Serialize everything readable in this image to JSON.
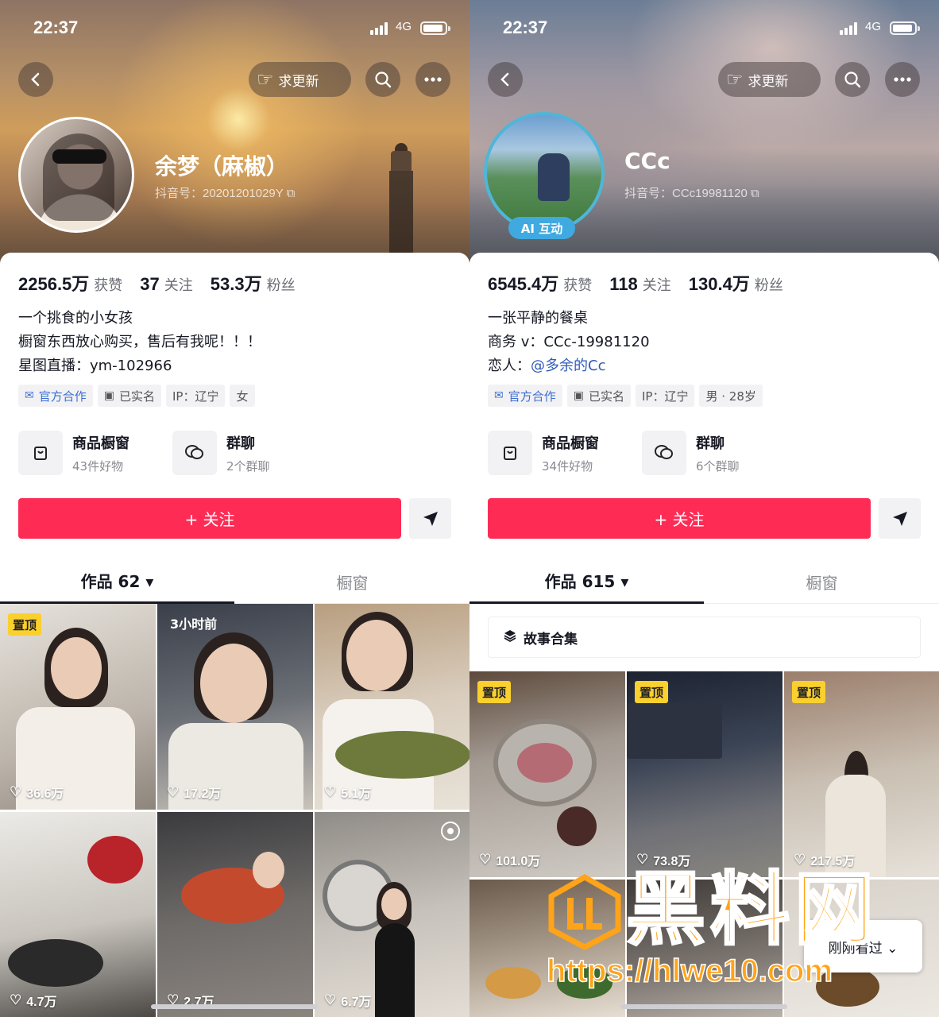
{
  "status": {
    "time": "22:37",
    "network": "4G"
  },
  "header": {
    "request_update": "求更新"
  },
  "left": {
    "name": "余梦（麻椒）",
    "uid": "抖音号：20201201029Y",
    "stats": [
      {
        "num": "2256.5万",
        "label": "获赞"
      },
      {
        "num": "37",
        "label": "关注"
      },
      {
        "num": "53.3万",
        "label": "粉丝"
      }
    ],
    "bio": [
      "一个挑食的小女孩",
      "橱窗东西放心购买，售后有我呢！！！",
      "星图直播：ym-102966"
    ],
    "tags": [
      "官方合作",
      "已实名",
      "IP：辽宁",
      "女"
    ],
    "shortcuts": [
      {
        "title": "商品橱窗",
        "sub": "43件好物"
      },
      {
        "title": "群聊",
        "sub": "2个群聊"
      }
    ],
    "follow": "+ 关注",
    "tabs": [
      "作品 62 ▾",
      "橱窗"
    ],
    "tiles": [
      {
        "badge": "置顶",
        "likes": "36.6万"
      },
      {
        "ago": "3小时前",
        "likes": "17.2万"
      },
      {
        "likes": "5.1万"
      },
      {
        "likes": "4.7万"
      },
      {
        "likes": "2.7万"
      },
      {
        "likes": "6.7万"
      }
    ]
  },
  "right": {
    "name": "CCc",
    "uid": "抖音号：CCc19981120",
    "ai_badge": "AI 互动",
    "stats": [
      {
        "num": "6545.4万",
        "label": "获赞"
      },
      {
        "num": "118",
        "label": "关注"
      },
      {
        "num": "130.4万",
        "label": "粉丝"
      }
    ],
    "bio_line1": "一张平静的餐桌",
    "bio_line2": "商务 v：CCc-19981120",
    "bio_line3_prefix": "恋人：",
    "bio_line3_mention": "@多余的Cc",
    "tags": [
      "官方合作",
      "已实名",
      "IP：辽宁",
      "男 · 28岁"
    ],
    "shortcuts": [
      {
        "title": "商品橱窗",
        "sub": "34件好物"
      },
      {
        "title": "群聊",
        "sub": "6个群聊"
      }
    ],
    "follow": "+ 关注",
    "tabs": [
      "作品 615 ▾",
      "橱窗"
    ],
    "story": "故事合集",
    "tiles": [
      {
        "badge": "置顶",
        "likes": "101.0万"
      },
      {
        "badge": "置顶",
        "likes": "73.8万"
      },
      {
        "badge": "置顶",
        "likes": "217.5万"
      }
    ],
    "recent": "刚刚看过 ⌄"
  },
  "watermark": {
    "big": "黑料网",
    "url": "https://hlwe10.com"
  },
  "colors": {
    "accent": "#fe2c55",
    "badge": "#fad02e",
    "watermark": "#ffa318"
  },
  "icons": [
    "back-icon",
    "hand-icon",
    "search-icon",
    "more-icon",
    "copy-icon",
    "shop-icon",
    "chat-icon",
    "share-icon",
    "heart-icon",
    "layers-icon",
    "live-icon"
  ]
}
